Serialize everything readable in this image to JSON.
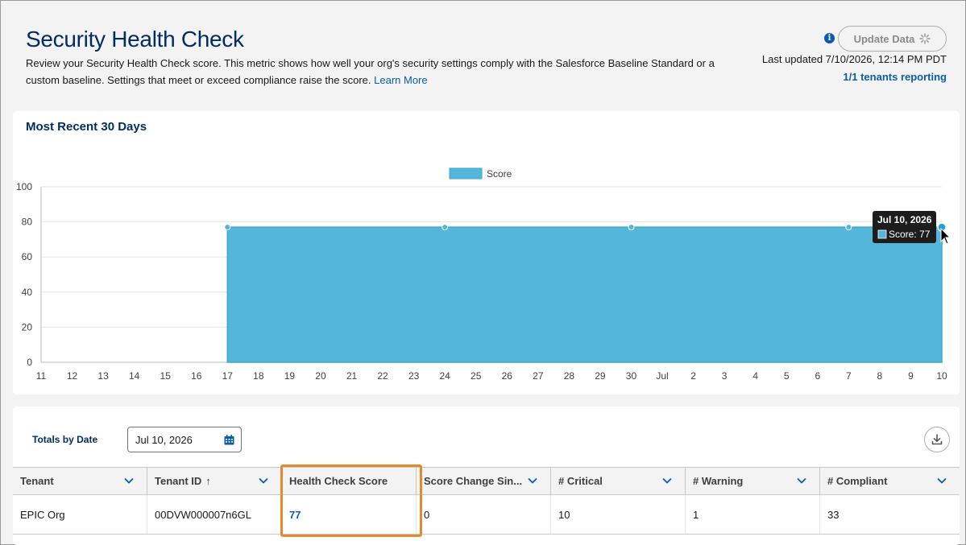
{
  "header": {
    "title": "Security Health Check",
    "description": "Review your Security Health Check score. This metric shows how well your org's security settings comply with the Salesforce Baseline Standard or a custom baseline. Settings that meet or exceed compliance raise the score.",
    "learn_more": "Learn More",
    "update_button": "Update Data",
    "last_updated": "Last updated 7/10/2026, 12:14 PM PDT",
    "tenants_reporting": "1/1 tenants reporting",
    "info_icon": "info-icon"
  },
  "chart_card": {
    "title": "Most Recent 30 Days"
  },
  "chart_data": {
    "type": "area",
    "legend": [
      "Score"
    ],
    "legend_position": "top-center",
    "x": [
      "11",
      "12",
      "13",
      "14",
      "15",
      "16",
      "17",
      "18",
      "19",
      "20",
      "21",
      "22",
      "23",
      "24",
      "25",
      "26",
      "27",
      "28",
      "29",
      "30",
      "Jul",
      "2",
      "3",
      "4",
      "5",
      "6",
      "7",
      "8",
      "9",
      "10"
    ],
    "series": [
      {
        "name": "Score",
        "values": [
          null,
          null,
          null,
          null,
          null,
          null,
          77,
          77,
          77,
          77,
          77,
          77,
          77,
          77,
          77,
          77,
          77,
          77,
          77,
          77,
          77,
          77,
          77,
          77,
          77,
          77,
          77,
          77,
          77,
          77
        ]
      }
    ],
    "markers_at": [
      "17",
      "24",
      "30",
      "7",
      "10"
    ],
    "ylim": [
      0,
      100
    ],
    "yticks": [
      0,
      20,
      40,
      60,
      80,
      100
    ],
    "grid": true,
    "color": "#54b6da",
    "tooltip": {
      "date": "Jul 10, 2026",
      "label": "Score: 77"
    }
  },
  "table_card": {
    "totals_label": "Totals by Date",
    "date_value": "Jul 10, 2026",
    "columns": [
      "Tenant",
      "Tenant ID",
      "Health Check Score",
      "Score Change Sin...",
      "# Critical",
      "# Warning",
      "# Compliant"
    ],
    "rows": [
      [
        "EPIC Org",
        "00DVW000007n6GL",
        "77",
        "0",
        "10",
        "1",
        "33"
      ]
    ],
    "sort_indicator": "↑"
  }
}
